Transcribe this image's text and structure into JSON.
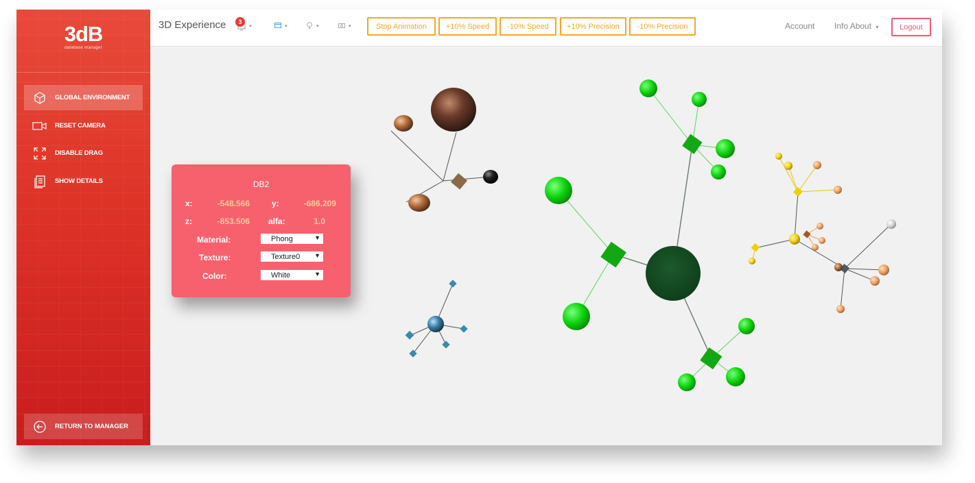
{
  "sidebar": {
    "logo": "3dB",
    "logo_sub": "database manager",
    "items": [
      {
        "label": "GLOBAL ENVIRONMENT",
        "icon": "cube-icon"
      },
      {
        "label": "RESET CAMERA",
        "icon": "camera-icon"
      },
      {
        "label": "DISABLE DRAG",
        "icon": "expand-arrows-icon"
      },
      {
        "label": "SHOW DETAILS",
        "icon": "details-icon"
      }
    ],
    "return_label": "RETURN TO MANAGER"
  },
  "topbar": {
    "brand": "3D Experience",
    "notification_count": "3",
    "buttons": {
      "stop": "Stop Animation",
      "speed_up": "+10% Speed",
      "speed_down": "-10% Speed",
      "prec_up": "+10% Precision",
      "prec_down": "-10% Precision"
    },
    "account": "Account",
    "info": "Info About",
    "logout": "Logout"
  },
  "details": {
    "title": "DB2",
    "x_label": "x:",
    "x_value": "-548.566",
    "y_label": "y:",
    "y_value": "-686.209",
    "z_label": "z:",
    "z_value": "-853.506",
    "alfa_label": "alfa:",
    "alfa_value": "1.0",
    "material_label": "Material:",
    "material_value": "Phong",
    "texture_label": "Texture:",
    "texture_value": "Texture0",
    "color_label": "Color:",
    "color_value": "White"
  },
  "colors": {
    "sidebar": "#dd3327",
    "panel": "#f7616d",
    "orange": "#f5a623",
    "green_node": "#14d114",
    "center_node": "#124a22"
  }
}
